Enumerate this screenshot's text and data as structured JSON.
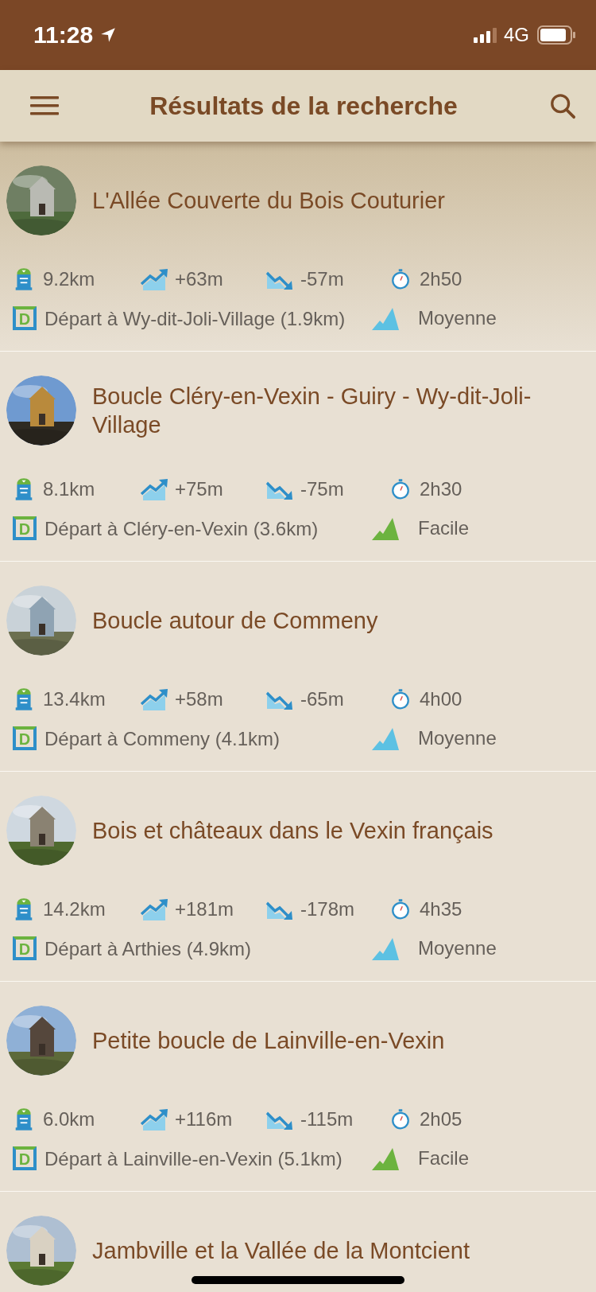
{
  "status_bar": {
    "time": "11:28",
    "network": "4G"
  },
  "header": {
    "title": "Résultats de la recherche"
  },
  "results": [
    {
      "title": "L'Allée Couverte du Bois Couturier",
      "distance": "9.2km",
      "ascent": "+63m",
      "descent": "-57m",
      "duration": "2h50",
      "start_marker": "D",
      "start": "Départ à Wy-dit-Joli-Village (1.9km)",
      "difficulty": "Moyenne",
      "color": "#5cc1e3"
    },
    {
      "title": "Boucle Cléry-en-Vexin - Guiry - Wy-dit-Joli-Village",
      "distance": "8.1km",
      "ascent": "+75m",
      "descent": "-75m",
      "duration": "2h30",
      "start_marker": "D",
      "start": "Départ à Cléry-en-Vexin (3.6km)",
      "difficulty": "Facile",
      "color": "#6cb33f"
    },
    {
      "title": "Boucle autour de Commeny",
      "distance": "13.4km",
      "ascent": "+58m",
      "descent": "-65m",
      "duration": "4h00",
      "start_marker": "D",
      "start": "Départ à Commeny (4.1km)",
      "difficulty": "Moyenne",
      "color": "#5cc1e3"
    },
    {
      "title": "Bois et châteaux dans le Vexin français",
      "distance": "14.2km",
      "ascent": "+181m",
      "descent": "-178m",
      "duration": "4h35",
      "start_marker": "D",
      "start": "Départ à Arthies (4.9km)",
      "difficulty": "Moyenne",
      "color": "#5cc1e3"
    },
    {
      "title": "Petite boucle de Lainville-en-Vexin",
      "distance": "6.0km",
      "ascent": "+116m",
      "descent": "-115m",
      "duration": "2h05",
      "start_marker": "D",
      "start": "Départ à Lainville-en-Vexin (5.1km)",
      "difficulty": "Facile",
      "color": "#6cb33f"
    },
    {
      "title": "Jambville et la Vallée de la Montcient"
    }
  ]
}
